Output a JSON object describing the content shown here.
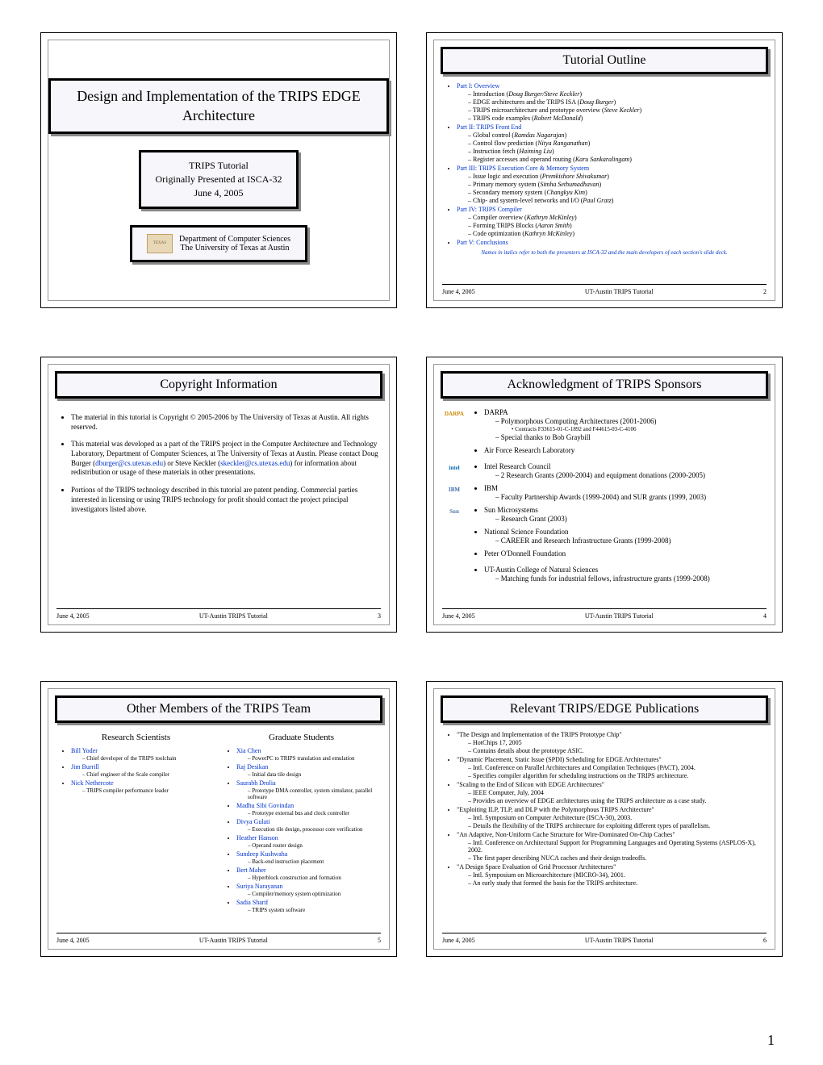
{
  "page_number": "1",
  "footer": {
    "date": "June 4, 2005",
    "center": "UT-Austin TRIPS Tutorial"
  },
  "s1": {
    "title": "Design and Implementation of the TRIPS EDGE Architecture",
    "sub_l1": "TRIPS Tutorial",
    "sub_l2": "Originally Presented at ISCA-32",
    "sub_l3": "June 4, 2005",
    "dept_l1": "Department of Computer Sciences",
    "dept_l2": "The University of Texas at Austin"
  },
  "s2": {
    "title": "Tutorial Outline",
    "p1": "Part I: Overview",
    "p1a": "Introduction (",
    "p1a_i": "Doug Burger/Steve Keckler",
    "p1a_end": ")",
    "p1b": "EDGE architectures and the TRIPS ISA (",
    "p1b_i": "Doug Burger",
    "p1b_end": ")",
    "p1c": "TRIPS microarchitecture and prototype overview (",
    "p1c_i": "Steve Keckler",
    "p1c_end": ")",
    "p1d": "TRIPS code examples (",
    "p1d_i": "Robert McDonald",
    "p1d_end": ")",
    "p2": "Part II: TRIPS Front End",
    "p2a": "Global control (",
    "p2a_i": "Ramdas Nagarajan",
    "p2a_end": ")",
    "p2b": "Control flow prediction (",
    "p2b_i": "Nitya Ranganathan",
    "p2b_end": ")",
    "p2c": "Instruction fetch (",
    "p2c_i": "Haiming Liu",
    "p2c_end": ")",
    "p2d": "Register accesses and operand routing (",
    "p2d_i": "Karu Sankaralingam",
    "p2d_end": ")",
    "p3": "Part III: TRIPS Execution Core & Memory System",
    "p3a": "Issue logic and execution (",
    "p3a_i": "Premkishore Shivakumar",
    "p3a_end": ")",
    "p3b": "Primary memory system (",
    "p3b_i": "Simha Sethumadhavan",
    "p3b_end": ")",
    "p3c": "Secondary memory system (",
    "p3c_i": "Changkyu Kim",
    "p3c_end": ")",
    "p3d": "Chip- and system-level networks and I/O (",
    "p3d_i": "Paul Gratz",
    "p3d_end": ")",
    "p4": "Part IV: TRIPS Compiler",
    "p4a": "Compiler overview (",
    "p4a_i": "Kathryn McKinley",
    "p4a_end": ")",
    "p4b": "Forming TRIPS Blocks (",
    "p4b_i": "Aaron Smith",
    "p4b_end": ")",
    "p4c": "Code optimization (",
    "p4c_i": "Kathryn McKinley",
    "p4c_end": ")",
    "p5": "Part V: Conclusions",
    "note": "Names in italics refer to both the presenters at ISCA-32 and the main developers of each section's slide deck.",
    "num": "2"
  },
  "s3": {
    "title": "Copyright Information",
    "b1": "The material in this tutorial is Copyright © 2005-2006 by The University of Texas at Austin.  All rights reserved.",
    "b2a": "This material was developed as a part of the TRIPS project in the Computer Architecture and Technology Laboratory, Department of Computer Sciences, at The University of Texas at Austin. Please contact Doug Burger (",
    "b2_link1": "dburger@cs.utexas.edu",
    "b2b": ") or Steve Keckler (",
    "b2_link2": "skeckler@cs.utexas.edu",
    "b2c": ") for information about redistribution or usage of these materials in other presentations.",
    "b3": "Portions of the TRIPS technology described in this tutorial are patent pending. Commercial parties interested in licensing or using TRIPS technology for profit should contact the project principal investigators listed above.",
    "num": "3"
  },
  "s4": {
    "title": "Acknowledgment of TRIPS Sponsors",
    "sp": [
      {
        "logo": "DARPA",
        "name": "DARPA",
        "sub": [
          "Polymorphous Computing Architectures (2001-2006)"
        ],
        "sub2": [
          "Contracts F33615-01-C-1892 and F44615-03-C-4106"
        ],
        "extra": "Special thanks to Bob Graybill"
      },
      {
        "logo": "",
        "name": "Air Force Research Laboratory",
        "sub": []
      },
      {
        "logo": "intel",
        "name": "Intel Research Council",
        "sub": [
          "2 Research Grants (2000-2004) and equipment donations (2000-2005)"
        ]
      },
      {
        "logo": "IBM",
        "name": "IBM",
        "sub": [
          "Faculty Partnership Awards (1999-2004) and SUR grants (1999, 2003)"
        ]
      },
      {
        "logo": "Sun",
        "name": "Sun Microsystems",
        "sub": [
          "Research Grant (2003)"
        ]
      },
      {
        "logo": "",
        "name": "National Science Foundation",
        "sub": [
          "CAREER and Research Infrastructure Grants (1999-2008)"
        ]
      },
      {
        "logo": "",
        "name": "Peter O'Donnell Foundation",
        "sub": []
      },
      {
        "logo": "",
        "name": "UT-Austin College of Natural Sciences",
        "sub": [
          "Matching funds for industrial fellows, infrastructure grants (1999-2008)"
        ]
      }
    ],
    "num": "4"
  },
  "s5": {
    "title": "Other Members of the TRIPS Team",
    "h1": "Research Scientists",
    "h2": "Graduate Students",
    "rs": [
      {
        "n": "Bill Yoder",
        "r": "Chief developer of the TRIPS toolchain"
      },
      {
        "n": "Jim Burrill",
        "r": "Chief engineer of the Scale compiler"
      },
      {
        "n": "Nick Nethercote",
        "r": "TRIPS compiler performance leader"
      }
    ],
    "gs": [
      {
        "n": "Xia Chen",
        "r": "PowerPC to TRIPS translation and emulation"
      },
      {
        "n": "Raj Desikan",
        "r": "Initial data tile design"
      },
      {
        "n": "Saurabh Drolia",
        "r": "Prototype DMA controller, system simulator, parallel software"
      },
      {
        "n": "Madhu Sibi Govindan",
        "r": "Prototype external bus and clock controller"
      },
      {
        "n": "Divya Gulati",
        "r": "Execution tile design, processor core verification"
      },
      {
        "n": "Heather Hanson",
        "r": "Operand router design"
      },
      {
        "n": "Sundeep Kushwaha",
        "r": "Back-end instruction placement"
      },
      {
        "n": "Bert Maher",
        "r": "Hyperblock construction and formation"
      },
      {
        "n": "Suriya Narayanan",
        "r": "Compiler/memory system optimization"
      },
      {
        "n": "Sadia Sharif",
        "r": "TRIPS system software"
      }
    ],
    "num": "5"
  },
  "s6": {
    "title": "Relevant TRIPS/EDGE Publications",
    "pubs": [
      {
        "t": "\"The Design and Implementation of the TRIPS Prototype Chip\"",
        "s": [
          "HotChips 17, 2005",
          "Contains details about the prototype ASIC."
        ]
      },
      {
        "t": "\"Dynamic Placement, Static Issue (SPDI) Scheduling for EDGE Architectures\"",
        "s": [
          "Intl. Conference on Parallel Architectures and Compilation Techniques (PACT), 2004.",
          "Specifies compiler algorithm for scheduling instructions on the TRIPS architecture."
        ]
      },
      {
        "t": "\"Scaling to the End of Silicon with EDGE Architectures\"",
        "s": [
          "IEEE Computer, July, 2004",
          "Provides an overview of EDGE architectures using the TRIPS architecture as a case study."
        ]
      },
      {
        "t": "\"Exploiting ILP, TLP, and DLP with the Polymorphous TRIPS Architecture\"",
        "s": [
          "Intl. Symposium on Computer Architecture (ISCA-30), 2003.",
          "Details the flexibility of the TRIPS architecture for exploiting different types of parallelism."
        ]
      },
      {
        "t": "\"An Adaptive, Non-Uniform Cache Structure for Wire-Dominated On-Chip Caches\"",
        "s": [
          "Intl. Conference on Architectural Support for Programming Languages and Operating Systems (ASPLOS-X), 2002.",
          "The first paper describing NUCA caches and their design tradeoffs."
        ]
      },
      {
        "t": "\"A Design Space Evaluation of Grid Processor Architectures\"",
        "s": [
          "Intl. Symposium on Microarchitecture (MICRO-34), 2001.",
          "An early study that formed the basis for the TRIPS architecture."
        ]
      }
    ],
    "num": "6"
  }
}
